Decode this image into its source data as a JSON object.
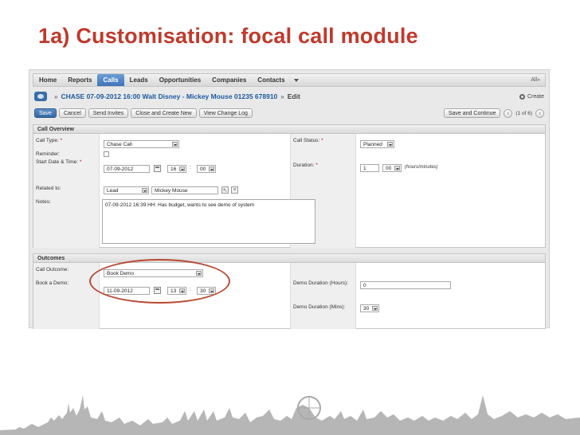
{
  "slide": {
    "title": "1a) Customisation: focal call module"
  },
  "nav": {
    "items": [
      "Home",
      "Reports",
      "Calls",
      "Leads",
      "Opportunities",
      "Companies",
      "Contacts"
    ],
    "active_index": 2,
    "all_label": "All"
  },
  "record": {
    "title": "CHASE 07-09-2012 16:00 Walt Disney - Mickey Mouse 01235 678910",
    "edit": "Edit",
    "create": "Create"
  },
  "toolbar": {
    "save": "Save",
    "cancel": "Cancel",
    "send_invites": "Send Invites",
    "close_create": "Close and Create New",
    "view_change_log": "View Change Log",
    "save_continue": "Save and Continue",
    "pager": "(1 of 6)"
  },
  "overview": {
    "heading": "Call Overview",
    "call_type_label": "Call Type:",
    "call_type_value": "Chase Call",
    "reminder_label": "Reminder:",
    "start_label": "Start Date & Time:",
    "start_date": "07-09-2012",
    "start_hour": "16",
    "start_min": "00",
    "related_label": "Related to:",
    "related_type": "Lead",
    "related_name": "Mickey Mouse",
    "notes_label": "Notes:",
    "notes_value": "07-09-2012 16:39 HH: Has budget, wants to see demo of system",
    "status_label": "Call Status:",
    "status_value": "Planned",
    "duration_label": "Duration:",
    "duration_hours": "1",
    "duration_mins": "00",
    "duration_hint": "(hours/minutes)"
  },
  "outcomes": {
    "heading": "Outcomes",
    "outcome_label": "Call Outcome:",
    "outcome_value": "Book Demo",
    "book_label": "Book a Demo:",
    "book_date": "11-09-2012",
    "book_hour": "13",
    "book_min": "30",
    "demo_hours_label": "Demo Duration (Hours):",
    "demo_hours_value": "0",
    "demo_mins_label": "Demo Duration (Mins):",
    "demo_mins_value": "30"
  },
  "colors": {
    "title": "#c0392b",
    "ring": "#b84a32",
    "active_tab": "#3f74b8",
    "link": "#1d5aa0"
  }
}
